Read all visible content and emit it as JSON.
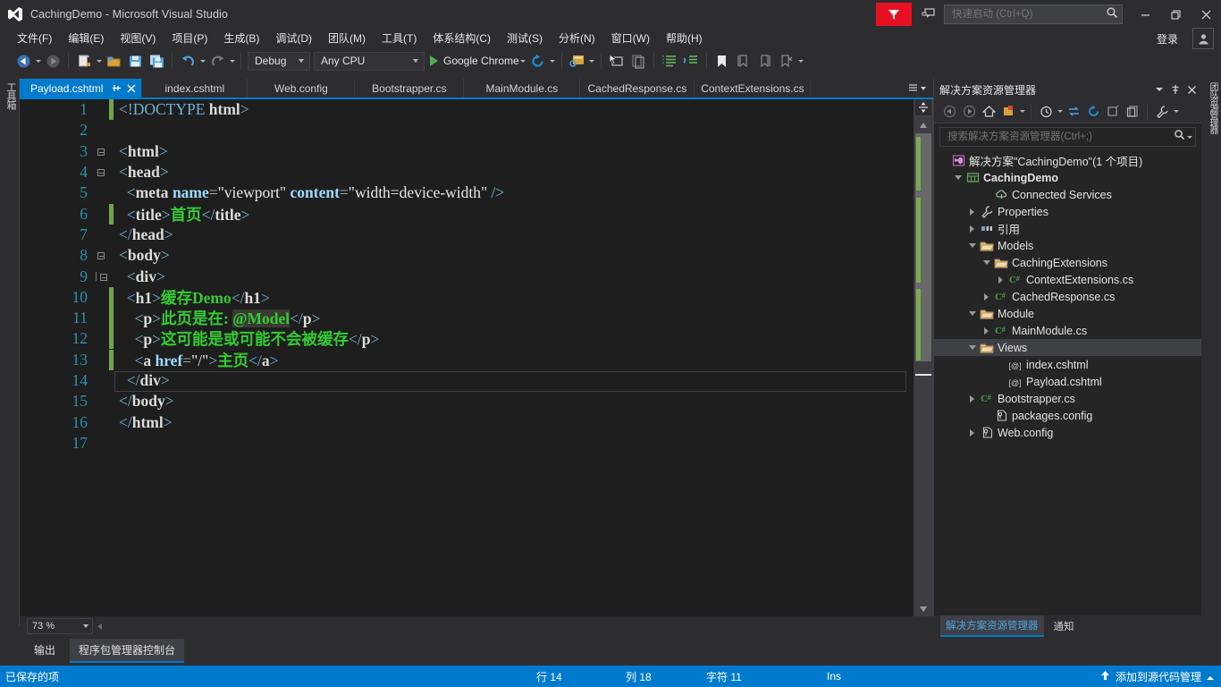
{
  "window": {
    "title": "CachingDemo - Microsoft Visual Studio",
    "minimize": "minimize",
    "maximize": "maximize",
    "close": "close"
  },
  "menu": {
    "items": [
      {
        "label": "文件(F)"
      },
      {
        "label": "编辑(E)"
      },
      {
        "label": "视图(V)"
      },
      {
        "label": "项目(P)"
      },
      {
        "label": "生成(B)"
      },
      {
        "label": "调试(D)"
      },
      {
        "label": "团队(M)"
      },
      {
        "label": "工具(T)"
      },
      {
        "label": "体系结构(C)"
      },
      {
        "label": "测试(S)"
      },
      {
        "label": "分析(N)"
      },
      {
        "label": "窗口(W)"
      },
      {
        "label": "帮助(H)"
      }
    ],
    "signin": "登录"
  },
  "quicklaunch": {
    "placeholder": "快速启动 (Ctrl+Q)",
    "value": ""
  },
  "toolbar": {
    "configuration": "Debug",
    "platform": "Any CPU",
    "run_target": "Google Chrome"
  },
  "toolbox_tab": "工具箱",
  "right_tab": "团队资源管理器",
  "editor_tabs": [
    {
      "label": "Payload.cshtml",
      "active": true
    },
    {
      "label": "index.cshtml",
      "active": false
    },
    {
      "label": "Web.config",
      "active": false
    },
    {
      "label": "Bootstrapper.cs",
      "active": false
    },
    {
      "label": "MainModule.cs",
      "active": false
    },
    {
      "label": "CachedResponse.cs",
      "active": false
    },
    {
      "label": "ContextExtensions.cs",
      "active": false
    }
  ],
  "code": {
    "lines": [
      {
        "n": "1",
        "indent": 0,
        "fold": "none",
        "change": "saved",
        "tokens": [
          {
            "t": "doctype",
            "v": "<!DOCTYPE "
          },
          {
            "t": "name",
            "v": "html"
          },
          {
            "t": "doctype",
            "v": ">"
          }
        ]
      },
      {
        "n": "2",
        "indent": 0,
        "fold": "none",
        "change": "none",
        "tokens": []
      },
      {
        "n": "3",
        "indent": 0,
        "fold": "open",
        "change": "none",
        "tokens": [
          {
            "t": "tag",
            "v": "<"
          },
          {
            "t": "name",
            "v": "html"
          },
          {
            "t": "tag",
            "v": ">"
          }
        ]
      },
      {
        "n": "4",
        "indent": 0,
        "fold": "open",
        "change": "none",
        "tokens": [
          {
            "t": "tag",
            "v": "<"
          },
          {
            "t": "name",
            "v": "head"
          },
          {
            "t": "tag",
            "v": ">"
          }
        ]
      },
      {
        "n": "5",
        "indent": 1,
        "fold": "line",
        "change": "none",
        "tokens": [
          {
            "t": "tag",
            "v": "<"
          },
          {
            "t": "name",
            "v": "meta"
          },
          {
            "t": "plain",
            "v": " "
          },
          {
            "t": "attr",
            "v": "name"
          },
          {
            "t": "eq",
            "v": "="
          },
          {
            "t": "str",
            "v": "\"viewport\""
          },
          {
            "t": "plain",
            "v": " "
          },
          {
            "t": "attr",
            "v": "content"
          },
          {
            "t": "eq",
            "v": "="
          },
          {
            "t": "str",
            "v": "\"width=device-width\""
          },
          {
            "t": "plain",
            "v": " "
          },
          {
            "t": "tag",
            "v": "/>"
          }
        ]
      },
      {
        "n": "6",
        "indent": 1,
        "fold": "line",
        "change": "saved",
        "tokens": [
          {
            "t": "tag",
            "v": "<"
          },
          {
            "t": "name",
            "v": "title"
          },
          {
            "t": "tag",
            "v": ">"
          },
          {
            "t": "txt",
            "v": "首页"
          },
          {
            "t": "tag",
            "v": "</"
          },
          {
            "t": "name",
            "v": "title"
          },
          {
            "t": "tag",
            "v": ">"
          }
        ]
      },
      {
        "n": "7",
        "indent": 0,
        "fold": "line",
        "change": "none",
        "tokens": [
          {
            "t": "tag",
            "v": "</"
          },
          {
            "t": "name",
            "v": "head"
          },
          {
            "t": "tag",
            "v": ">"
          }
        ]
      },
      {
        "n": "8",
        "indent": 0,
        "fold": "open",
        "change": "none",
        "tokens": [
          {
            "t": "tag",
            "v": "<"
          },
          {
            "t": "name",
            "v": "body"
          },
          {
            "t": "tag",
            "v": ">"
          }
        ]
      },
      {
        "n": "9",
        "indent": 1,
        "fold": "open2",
        "change": "none",
        "tokens": [
          {
            "t": "tag",
            "v": "<"
          },
          {
            "t": "name",
            "v": "div"
          },
          {
            "t": "tag",
            "v": ">"
          }
        ]
      },
      {
        "n": "10",
        "indent": 1,
        "fold": "line",
        "change": "saved",
        "tokens": [
          {
            "t": "tag",
            "v": "<"
          },
          {
            "t": "name",
            "v": "h1"
          },
          {
            "t": "tag",
            "v": ">"
          },
          {
            "t": "txt",
            "v": "缓存Demo"
          },
          {
            "t": "tag",
            "v": "</"
          },
          {
            "t": "name",
            "v": "h1"
          },
          {
            "t": "tag",
            "v": ">"
          }
        ]
      },
      {
        "n": "11",
        "indent": 2,
        "fold": "line",
        "change": "saved",
        "tokens": [
          {
            "t": "tag",
            "v": "<"
          },
          {
            "t": "name",
            "v": "p"
          },
          {
            "t": "tag",
            "v": ">"
          },
          {
            "t": "txt",
            "v": "此页是在: "
          },
          {
            "t": "razor",
            "v": "@Model"
          },
          {
            "t": "tag",
            "v": "</"
          },
          {
            "t": "name",
            "v": "p"
          },
          {
            "t": "tag",
            "v": ">"
          }
        ]
      },
      {
        "n": "12",
        "indent": 2,
        "fold": "line",
        "change": "saved",
        "tokens": [
          {
            "t": "tag",
            "v": "<"
          },
          {
            "t": "name",
            "v": "p"
          },
          {
            "t": "tag",
            "v": ">"
          },
          {
            "t": "txt",
            "v": "这可能是或可能不会被缓存"
          },
          {
            "t": "tag",
            "v": "</"
          },
          {
            "t": "name",
            "v": "p"
          },
          {
            "t": "tag",
            "v": ">"
          }
        ]
      },
      {
        "n": "13",
        "indent": 2,
        "fold": "line",
        "change": "saved",
        "tokens": [
          {
            "t": "tag",
            "v": "<"
          },
          {
            "t": "name",
            "v": "a"
          },
          {
            "t": "plain",
            "v": " "
          },
          {
            "t": "attr",
            "v": "href"
          },
          {
            "t": "eq",
            "v": "="
          },
          {
            "t": "str",
            "v": "\"/\""
          },
          {
            "t": "tag",
            "v": ">"
          },
          {
            "t": "txt",
            "v": "主页"
          },
          {
            "t": "tag",
            "v": "</"
          },
          {
            "t": "name",
            "v": "a"
          },
          {
            "t": "tag",
            "v": ">"
          }
        ]
      },
      {
        "n": "14",
        "indent": 1,
        "fold": "line",
        "change": "none",
        "tokens": [
          {
            "t": "tag",
            "v": "</"
          },
          {
            "t": "name",
            "v": "div"
          },
          {
            "t": "tag",
            "v": ">"
          }
        ]
      },
      {
        "n": "15",
        "indent": 0,
        "fold": "line",
        "change": "none",
        "tokens": [
          {
            "t": "tag",
            "v": "</"
          },
          {
            "t": "name",
            "v": "body"
          },
          {
            "t": "tag",
            "v": ">"
          }
        ]
      },
      {
        "n": "16",
        "indent": 0,
        "fold": "line",
        "change": "none",
        "tokens": [
          {
            "t": "tag",
            "v": "</"
          },
          {
            "t": "name",
            "v": "html"
          },
          {
            "t": "tag",
            "v": ">"
          }
        ]
      },
      {
        "n": "17",
        "indent": 0,
        "fold": "none",
        "change": "none",
        "tokens": []
      }
    ],
    "current_line_index": 13
  },
  "zoom": {
    "level": "73 %"
  },
  "bottom_tabs": [
    {
      "label": "输出",
      "selected": false
    },
    {
      "label": "程序包管理器控制台",
      "selected": true
    }
  ],
  "solution_explorer": {
    "title": "解决方案资源管理器",
    "search_placeholder": "搜索解决方案资源管理器(Ctrl+;)",
    "tree": [
      {
        "label": "解决方案\"CachingDemo\"(1 个项目)",
        "depth": 0,
        "expander": "none",
        "icon": "solution-icon",
        "bold": false,
        "selected": false
      },
      {
        "label": "CachingDemo",
        "depth": 1,
        "expander": "down",
        "icon": "project-icon",
        "bold": true,
        "selected": false
      },
      {
        "label": "Connected Services",
        "depth": 3,
        "expander": "none",
        "icon": "cloud-icon",
        "bold": false,
        "selected": false
      },
      {
        "label": "Properties",
        "depth": 2,
        "expander": "right",
        "icon": "wrench-icon",
        "bold": false,
        "selected": false
      },
      {
        "label": "引用",
        "depth": 2,
        "expander": "right",
        "icon": "refs-icon",
        "bold": false,
        "selected": false
      },
      {
        "label": "Models",
        "depth": 2,
        "expander": "down",
        "icon": "folder-icon",
        "bold": false,
        "selected": false
      },
      {
        "label": "CachingExtensions",
        "depth": 3,
        "expander": "down",
        "icon": "folder-icon",
        "bold": false,
        "selected": false
      },
      {
        "label": "ContextExtensions.cs",
        "depth": 4,
        "expander": "right",
        "icon": "csharp-icon",
        "bold": false,
        "selected": false
      },
      {
        "label": "CachedResponse.cs",
        "depth": 3,
        "expander": "right",
        "icon": "csharp-icon",
        "bold": false,
        "selected": false
      },
      {
        "label": "Module",
        "depth": 2,
        "expander": "down",
        "icon": "folder-icon",
        "bold": false,
        "selected": false
      },
      {
        "label": "MainModule.cs",
        "depth": 3,
        "expander": "right",
        "icon": "csharp-icon",
        "bold": false,
        "selected": false
      },
      {
        "label": "Views",
        "depth": 2,
        "expander": "down",
        "icon": "folder-icon",
        "bold": false,
        "selected": true
      },
      {
        "label": "index.cshtml",
        "depth": 4,
        "expander": "none",
        "icon": "cshtml-icon",
        "bold": false,
        "selected": false
      },
      {
        "label": "Payload.cshtml",
        "depth": 4,
        "expander": "none",
        "icon": "cshtml-icon",
        "bold": false,
        "selected": false
      },
      {
        "label": "Bootstrapper.cs",
        "depth": 2,
        "expander": "right",
        "icon": "csharp-icon",
        "bold": false,
        "selected": false
      },
      {
        "label": "packages.config",
        "depth": 3,
        "expander": "none",
        "icon": "config-icon",
        "bold": false,
        "selected": false
      },
      {
        "label": "Web.config",
        "depth": 2,
        "expander": "right",
        "icon": "config-icon",
        "bold": false,
        "selected": false
      }
    ],
    "bottom_tabs": [
      {
        "label": "解决方案资源管理器",
        "selected": true
      },
      {
        "label": "通知",
        "selected": false
      }
    ]
  },
  "statusbar": {
    "message": "已保存的项",
    "line": "行 14",
    "column": "列 18",
    "chars": "字符 11",
    "insert_mode": "Ins",
    "source_control": "添加到源代码管理"
  },
  "colors": {
    "accent": "#007acc",
    "chrome": "#2d2d30",
    "editor_bg": "#1e1e1e",
    "panel_bg": "#252526",
    "feedback_red": "#e81123",
    "string_green": "#33cc33",
    "linenumber": "#2b91af"
  }
}
